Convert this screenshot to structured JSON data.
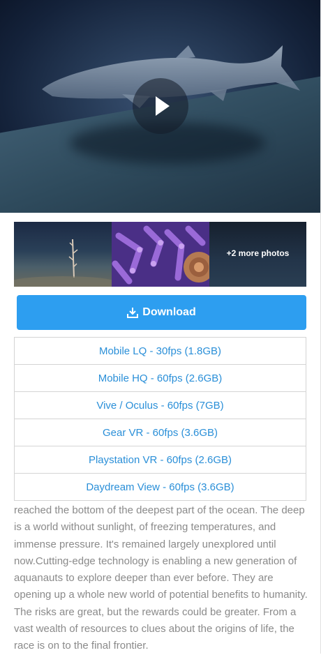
{
  "video": {
    "play_icon": "play-icon"
  },
  "gallery": {
    "more_photos_label": "+2 more photos"
  },
  "download": {
    "label": "Download",
    "icon": "download-icon",
    "accent_color": "#2d9ef0"
  },
  "options": [
    {
      "label": "Mobile LQ - 30fps (1.8GB)"
    },
    {
      "label": "Mobile HQ - 60fps (2.6GB)"
    },
    {
      "label": "Vive / Oculus - 60fps (7GB)"
    },
    {
      "label": "Gear VR - 60fps (3.6GB)"
    },
    {
      "label": "Playstation VR - 60fps (2.6GB)"
    },
    {
      "label": "Daydream View - 60fps (3.6GB)"
    }
  ],
  "description": "reached the bottom of the deepest part of the ocean. The deep is a world without sunlight, of freezing temperatures, and immense pressure. It's remained largely unexplored until now.Cutting-edge technology is enabling a new generation of aquanauts to explore deeper than ever before. They are opening up a whole new world of potential benefits to humanity. The risks are great, but the rewards could be greater. From a vast wealth of resources to clues about the origins of life, the race is on to the final frontier."
}
